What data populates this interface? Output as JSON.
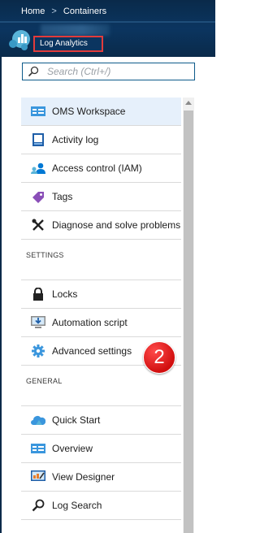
{
  "breadcrumb": {
    "home": "Home",
    "separator": ">",
    "current": "Containers"
  },
  "resource": {
    "label": "Log Analytics",
    "icon": "log-analytics-icon"
  },
  "search": {
    "placeholder": "Search (Ctrl+/)",
    "value": ""
  },
  "menu": {
    "top_items": [
      {
        "label": "OMS Workspace",
        "icon": "oms-workspace-icon",
        "selected": true
      },
      {
        "label": "Activity log",
        "icon": "activity-log-icon"
      },
      {
        "label": "Access control (IAM)",
        "icon": "access-control-icon"
      },
      {
        "label": "Tags",
        "icon": "tag-icon"
      },
      {
        "label": "Diagnose and solve problems",
        "icon": "wrench-cross-icon"
      }
    ],
    "settings_header": "SETTINGS",
    "settings_items": [
      {
        "label": "Locks",
        "icon": "lock-icon"
      },
      {
        "label": "Automation script",
        "icon": "download-monitor-icon"
      },
      {
        "label": "Advanced settings",
        "icon": "gear-icon"
      }
    ],
    "general_header": "GENERAL",
    "general_items": [
      {
        "label": "Quick Start",
        "icon": "cloud-icon"
      },
      {
        "label": "Overview",
        "icon": "overview-icon"
      },
      {
        "label": "View Designer",
        "icon": "view-designer-icon"
      },
      {
        "label": "Log Search",
        "icon": "magnifier-icon"
      }
    ]
  },
  "callout": {
    "number": "2"
  },
  "colors": {
    "header_bg": "#0a2a4a",
    "selected_bg": "#e6f0fb",
    "accent_blue": "#0078d4",
    "callout_red": "#d10f0f",
    "label_border": "#e23b3b"
  }
}
